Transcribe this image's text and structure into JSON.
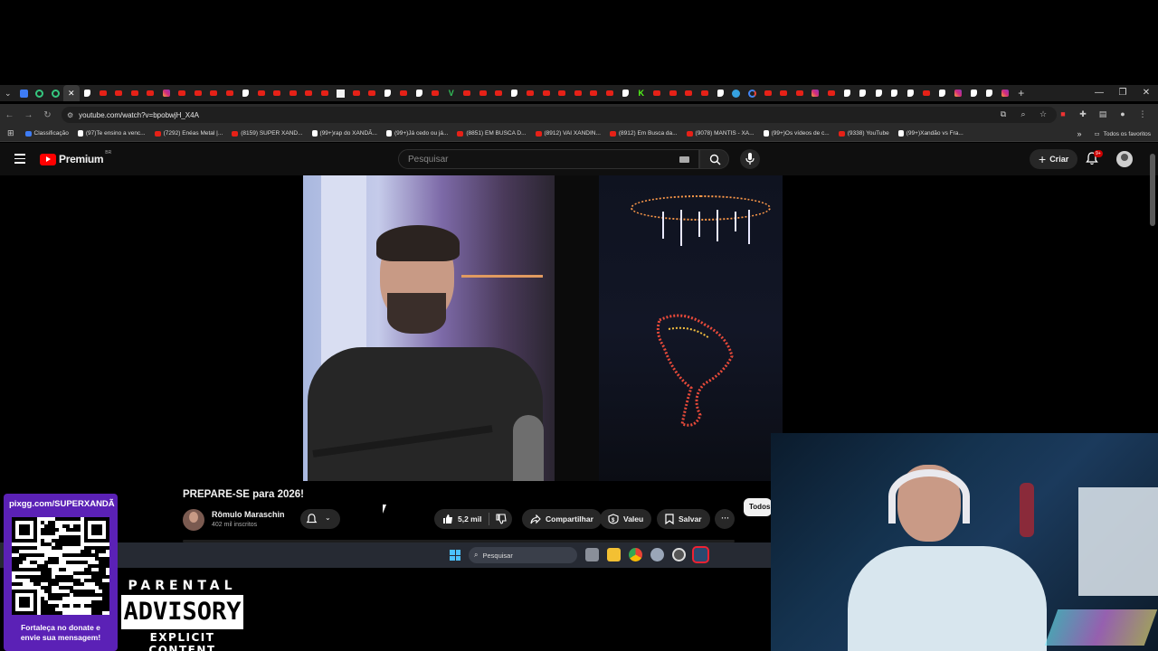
{
  "browser": {
    "url": "youtube.com/watch?v=bpobwjH_X4A",
    "bookmarks": [
      {
        "label": "Classificação",
        "icon": "bl"
      },
      {
        "label": "(97)Te ensino a venc...",
        "icon": "tt"
      },
      {
        "label": "(7292) Enéas Metal |...",
        "icon": "yt"
      },
      {
        "label": "(8159) SUPER XAND...",
        "icon": "yt"
      },
      {
        "label": "(99+)rap do XANDÃ...",
        "icon": "tt"
      },
      {
        "label": "(99+)Já cedo ou já...",
        "icon": "tt"
      },
      {
        "label": "(8851) EM BUSCA D...",
        "icon": "yt"
      },
      {
        "label": "(8912) VAI XANDIN...",
        "icon": "yt"
      },
      {
        "label": "(8912) Em Busca da...",
        "icon": "yt"
      },
      {
        "label": "(9078) MANTIS - XA...",
        "icon": "yt"
      },
      {
        "label": "(99+)Os vídeos de c...",
        "icon": "tt"
      },
      {
        "label": "(9338) YouTube",
        "icon": "yt"
      },
      {
        "label": "(99+)Xandão vs Fra...",
        "icon": "tt"
      }
    ],
    "all_bookmarks_label": "Todos os favoritos",
    "more_bookmarks": "»"
  },
  "youtube": {
    "logo": "Premium",
    "country": "BR",
    "search_placeholder": "Pesquisar",
    "create_label": "Criar",
    "notif_badge": "9+"
  },
  "video": {
    "title": "PREPARE-SE para 2026!",
    "channel": "Rômulo Maraschin",
    "subscribers": "402 mil inscritos",
    "likes": "5,2 mil",
    "share_label": "Compartilhar",
    "thanks_label": "Valeu",
    "save_label": "Salvar",
    "more": "···",
    "chip": "Todos"
  },
  "taskbar": {
    "search_label": "Pesquisar"
  },
  "overlay": {
    "donate_link": "pixgg.com/SUPERXANDÃ",
    "donate_msg_1": "Fortaleça no donate e",
    "donate_msg_2": "envie sua mensagem!",
    "pa_top": "PARENTAL",
    "pa_mid": "ADVISORY",
    "pa_bottom": "EXPLICIT CONTENT"
  },
  "colors": {
    "yt_red": "#ff0000",
    "donate_bg": "#5b21b6",
    "bg": "#0f0f0f"
  }
}
